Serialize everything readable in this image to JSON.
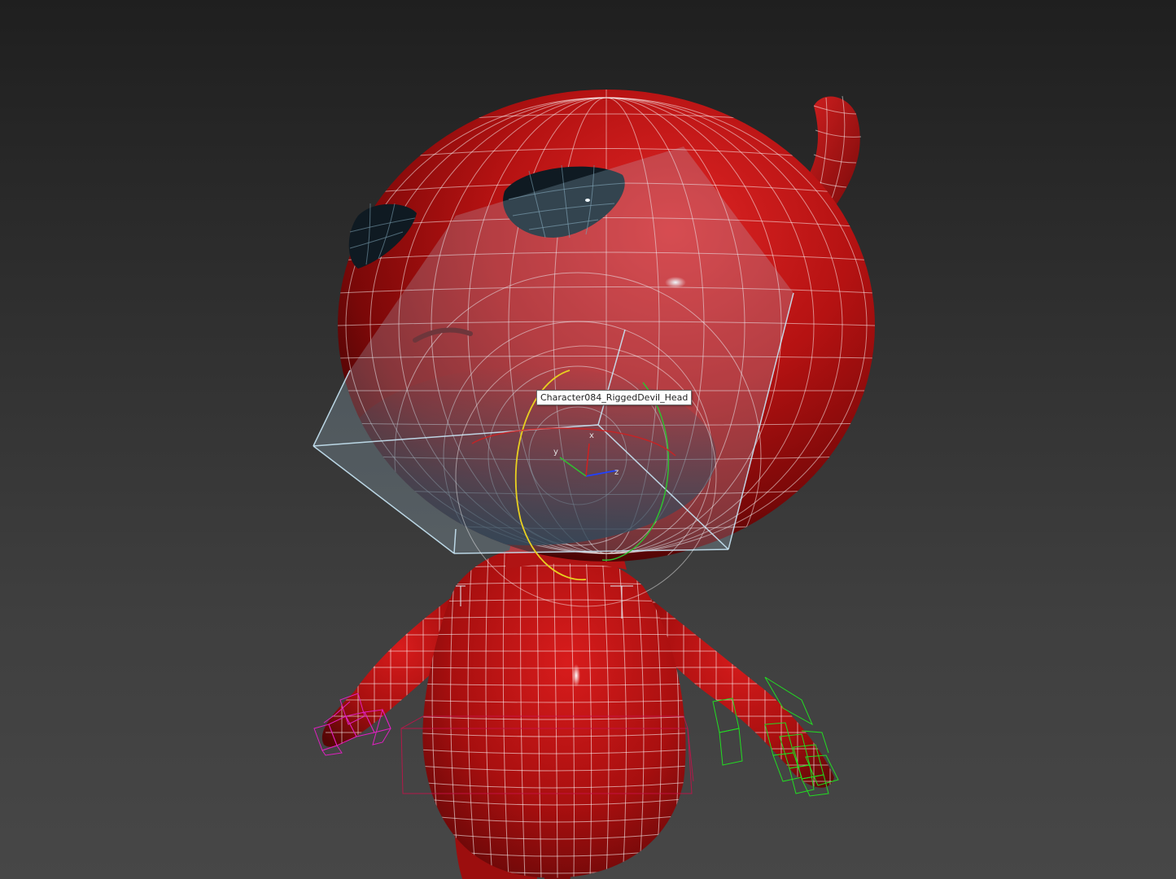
{
  "viewport": {
    "hover_tooltip": "Character084_RiggedDevil_Head",
    "gizmo_axes": [
      "x",
      "y",
      "z"
    ],
    "colors": {
      "background_top": "#1f1f1f",
      "background_bottom": "#474747",
      "model_red": "#b51212",
      "eye_dark": "#101c24",
      "wire_white": "#ffffff",
      "bone_left_hand": "#e020c0",
      "bone_right_hand": "#22dd22",
      "selection_box": "#b4dcf0",
      "rotate_ring_yellow": "#e8d020",
      "rotate_ring_green": "#30c030",
      "rotate_ring_red": "#d02020",
      "gizmo_blue": "#2040ff"
    }
  }
}
